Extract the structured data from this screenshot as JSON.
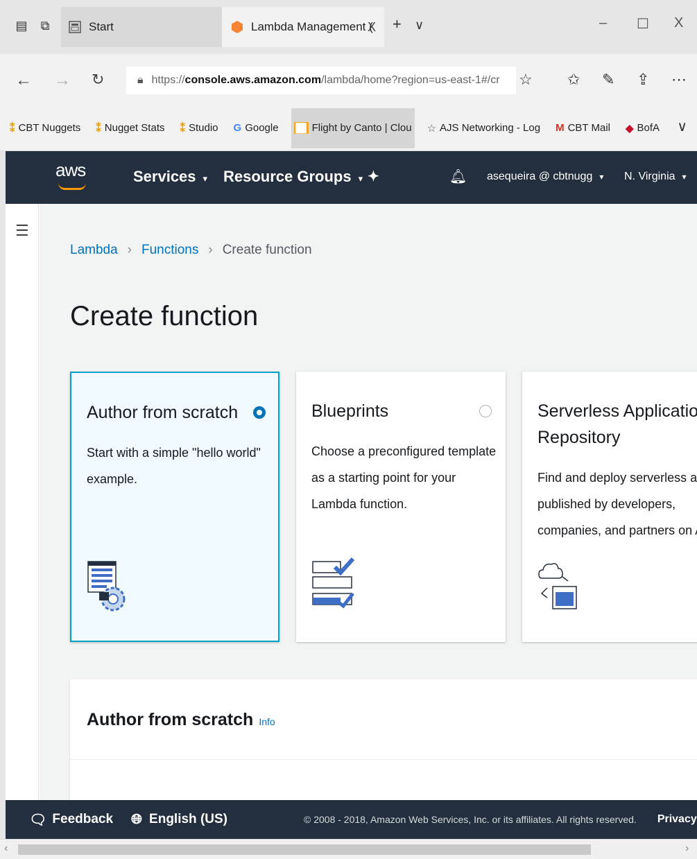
{
  "browser": {
    "tabs": [
      {
        "label": "Start"
      },
      {
        "label": "Lambda Management (",
        "close": "X"
      }
    ],
    "new_tab": "+",
    "tab_dropdown": "∨",
    "window_controls": {
      "minimize": "–",
      "maximize": "☐",
      "close": "X"
    },
    "url": {
      "prefix": "https://",
      "host": "console.aws.amazon.com",
      "path": "/lambda/home?region=us-east-1#/cr"
    },
    "favorites": [
      {
        "label": "CBT Nuggets",
        "icon": "nugget-icon"
      },
      {
        "label": "Nugget Stats",
        "icon": "nugget-icon"
      },
      {
        "label": "Studio",
        "icon": "nugget-icon"
      },
      {
        "label": "Google",
        "icon": "google-icon"
      },
      {
        "label": "Flight by Canto | Clou",
        "icon": "flight-icon"
      },
      {
        "label": "AJS Networking - Log",
        "icon": "star-icon"
      },
      {
        "label": "CBT Mail",
        "icon": "mail-icon"
      },
      {
        "label": "BofA",
        "icon": "bofa-icon"
      }
    ],
    "favorites_more": "∨"
  },
  "aws_nav": {
    "logo": "aws",
    "services": "Services",
    "resource_groups": "Resource Groups",
    "account": "asequeira @ cbtnugg",
    "region": "N. Virginia"
  },
  "breadcrumb": {
    "root": "Lambda",
    "middle": "Functions",
    "current": "Create function"
  },
  "page_title": "Create function",
  "cards": [
    {
      "title": "Author from scratch",
      "desc1": "Start with a simple \"hello world\"",
      "desc2": "example.",
      "selected": true
    },
    {
      "title": "Blueprints",
      "desc1": "Choose a preconfigured template",
      "desc2": "as a starting point for your",
      "desc3": "Lambda function.",
      "selected": false
    },
    {
      "title1": "Serverless Application",
      "title2": "Repository",
      "desc1": "Find and deploy serverless apps",
      "desc2": "published by developers,",
      "desc3": "companies, and partners on AWS",
      "selected": false
    }
  ],
  "section": {
    "title": "Author from scratch",
    "info": "Info"
  },
  "footer": {
    "feedback": "Feedback",
    "language": "English (US)",
    "copyright": "© 2008 - 2018, Amazon Web Services, Inc. or its affiliates. All rights reserved.",
    "privacy": "Privacy Poli"
  },
  "colors": {
    "aws_nav_bg": "#232f3e",
    "link": "#0073bb",
    "selected_border": "#00a1c9",
    "aws_orange": "#ff9900"
  }
}
